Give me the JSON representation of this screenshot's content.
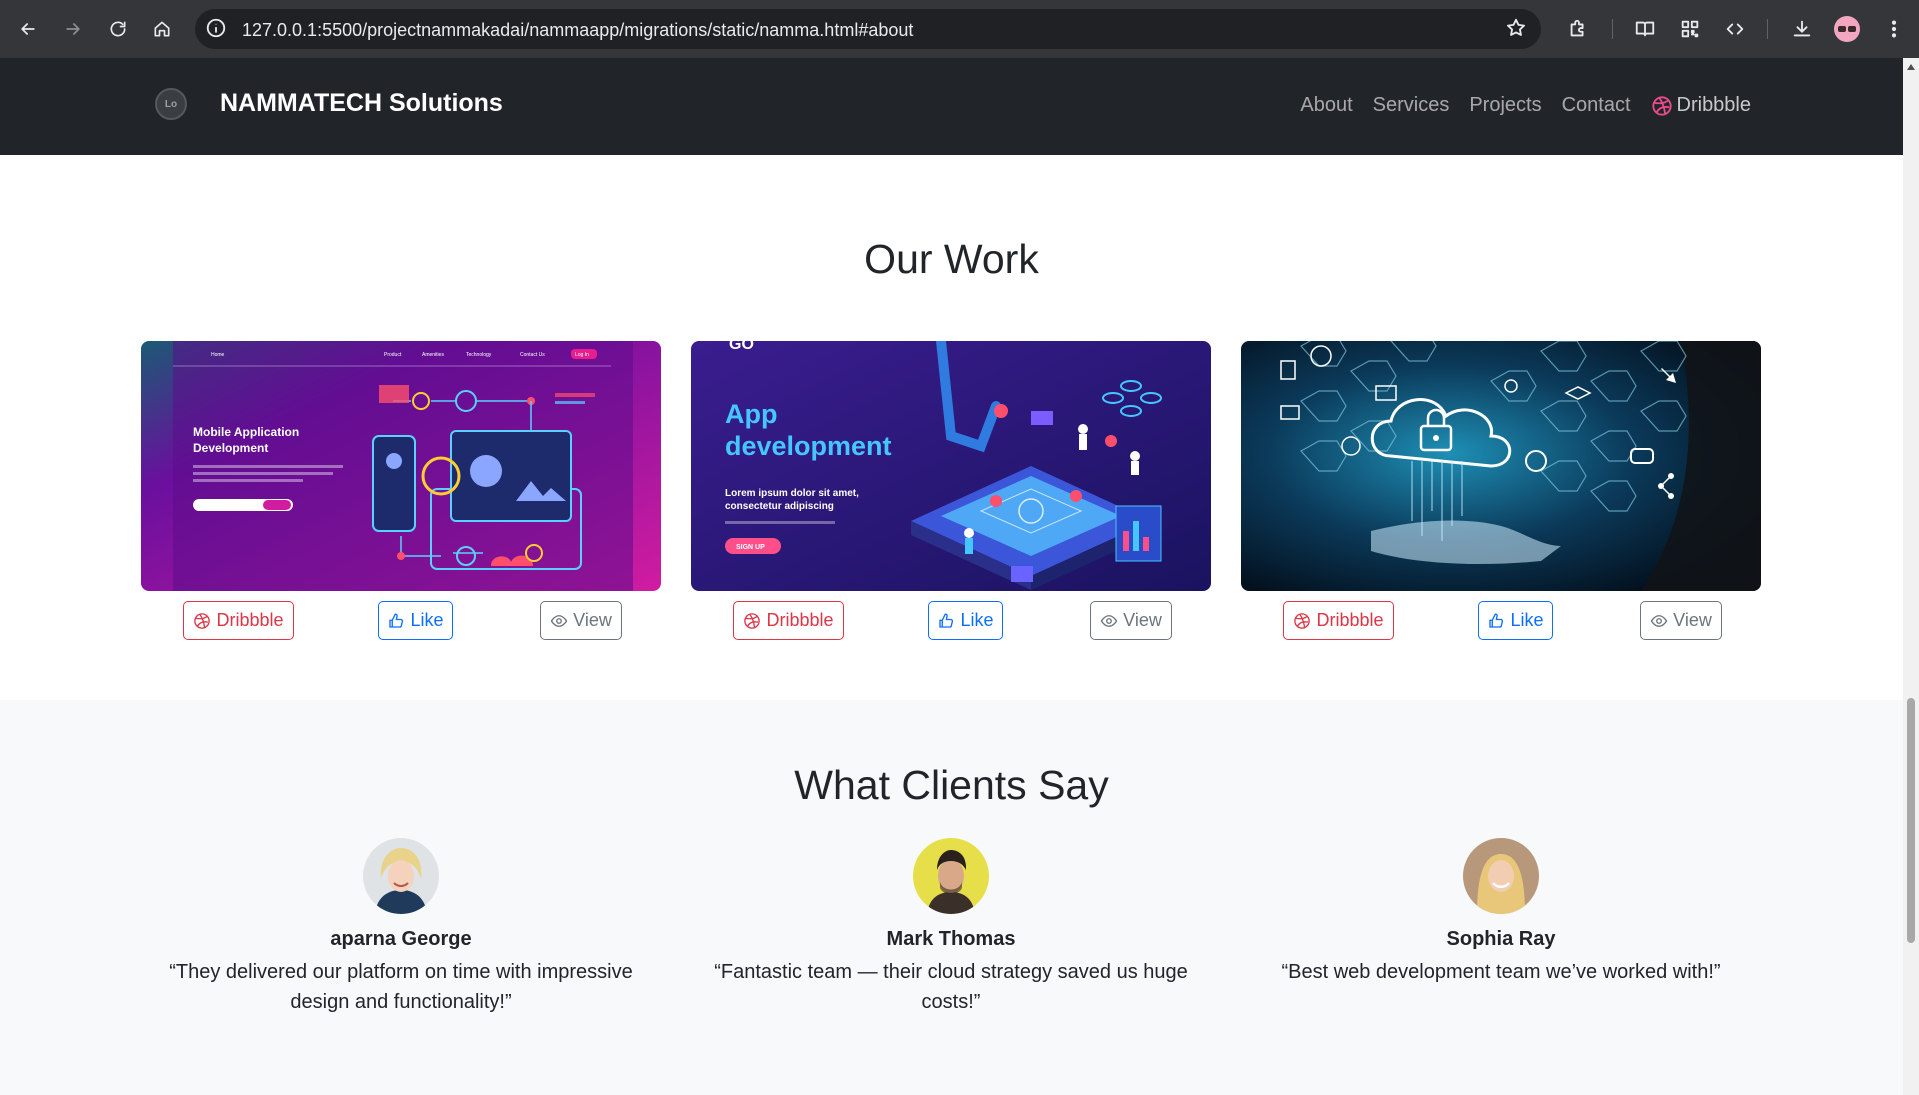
{
  "browser": {
    "url": "127.0.0.1:5500/projectnammakadai/nammaapp/migrations/static/namma.html#about"
  },
  "navbar": {
    "logo_text": "Lo",
    "brand": "NAMMATECH Solutions",
    "links": [
      "About",
      "Services",
      "Projects",
      "Contact"
    ],
    "dribbble": "Dribbble"
  },
  "work": {
    "title": "Our Work",
    "cards": [
      {
        "image_text": {
          "headline": "Mobile Application Development",
          "nav": [
            "Home",
            "Product",
            "Amenities",
            "Technology",
            "Contact Us",
            "Log In"
          ]
        },
        "buttons": {
          "dribbble": "Dribbble",
          "like": "Like",
          "view": "View"
        }
      },
      {
        "image_text": {
          "logo": "GO",
          "headline": "App development",
          "body": "Lorem ipsum dolor sit amet, consectetur adipiscing",
          "cta": "SIGN UP"
        },
        "buttons": {
          "dribbble": "Dribbble",
          "like": "Like",
          "view": "View"
        }
      },
      {
        "buttons": {
          "dribbble": "Dribbble",
          "like": "Like",
          "view": "View"
        }
      }
    ]
  },
  "clients": {
    "title": "What Clients Say",
    "testimonials": [
      {
        "name": "aparna George",
        "quote": "“They delivered our platform on time with impressive design and functionality!”"
      },
      {
        "name": "Mark Thomas",
        "quote": "“Fantastic team — their cloud strategy saved us huge costs!”"
      },
      {
        "name": "Sophia Ray",
        "quote": "“Best web development team we’ve worked with!”"
      }
    ]
  },
  "colors": {
    "navbar_bg": "#212529",
    "dribbble_red": "#dc3545",
    "like_blue": "#0d6efd",
    "view_gray": "#6c757d",
    "section_alt_bg": "#f8f9fa"
  }
}
